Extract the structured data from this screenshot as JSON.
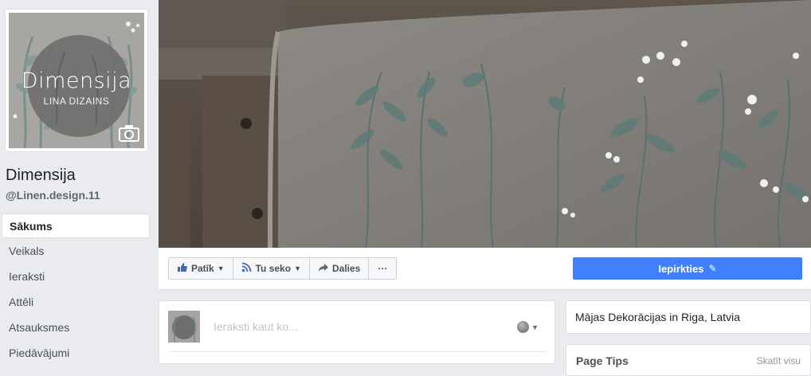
{
  "page": {
    "name": "Dimensija",
    "handle": "@Linen.design.11"
  },
  "profile_logo": {
    "title": "Dimensija",
    "subtitle": "LINA DIZAINS"
  },
  "nav": {
    "items": [
      {
        "label": "Sākums",
        "active": true
      },
      {
        "label": "Veikals",
        "active": false
      },
      {
        "label": "Ieraksti",
        "active": false
      },
      {
        "label": "Attēli",
        "active": false
      },
      {
        "label": "Atsauksmes",
        "active": false
      },
      {
        "label": "Piedāvājumi",
        "active": false
      }
    ]
  },
  "actions": {
    "like": "Patīk",
    "follow": "Tu seko",
    "share": "Dalies",
    "more": "···",
    "buy": "Iepirkties"
  },
  "composer": {
    "placeholder": "Ieraksti kaut ko..."
  },
  "right": {
    "location": "Mājas Dekorācijas in Riga, Latvia",
    "tips_title": "Page Tips",
    "tips_link": "Skatīt visu"
  },
  "colors": {
    "accent": "#4080ff",
    "link_blue": "#4267b2",
    "background": "#e9ebee"
  },
  "icons": {
    "like": "thumbs-up-icon",
    "follow": "rss-icon",
    "share": "share-arrow-icon",
    "buy": "pencil-icon",
    "camera": "camera-icon",
    "privacy": "globe-icon"
  }
}
